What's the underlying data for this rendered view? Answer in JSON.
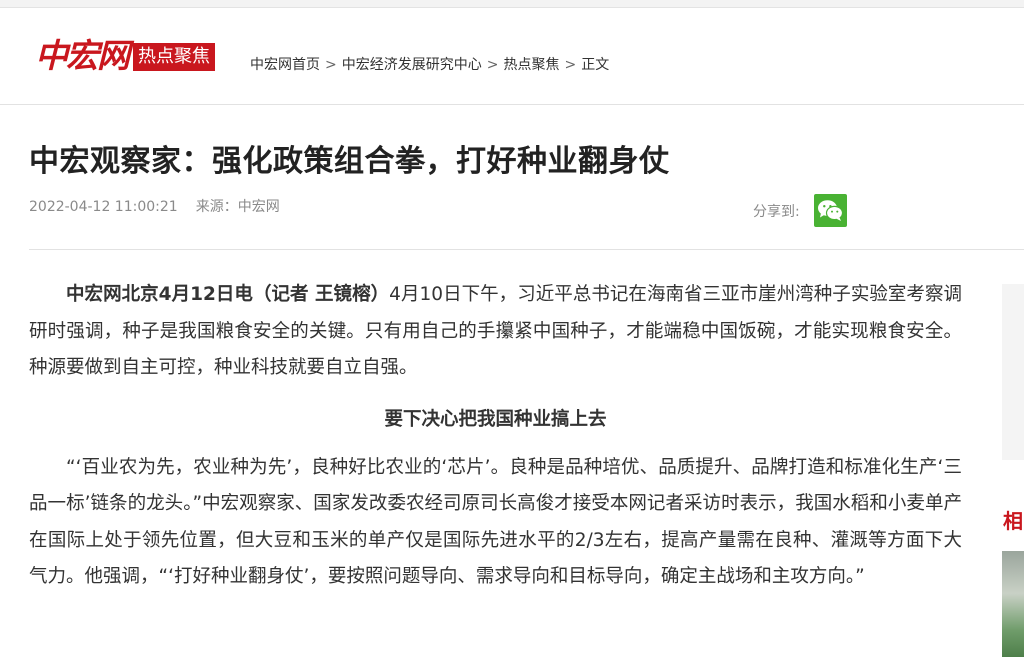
{
  "header": {
    "logo_text": "中宏网",
    "channel_tag": "热点聚焦",
    "breadcrumb": [
      "中宏网首页",
      "中宏经济发展研究中心",
      "热点聚焦",
      "正文"
    ],
    "breadcrumb_separator": ">"
  },
  "article": {
    "title": "中宏观察家：强化政策组合拳，打好种业翻身仗",
    "datetime": "2022-04-12 11:00:21",
    "source": "来源：中宏网",
    "share_label": "分享到:",
    "share_icon": "wechat-icon",
    "para1_lead": "中宏网北京4月12日电（记者 王镜榕）",
    "para1_body": "4月10日下午，习近平总书记在海南省三亚市崖州湾种子实验室考察调研时强调，种子是我国粮食安全的关键。只有用自己的手攥紧中国种子，才能端稳中国饭碗，才能实现粮食安全。种源要做到自主可控，种业科技就要自立自强。",
    "subheading": "要下决心把我国种业搞上去",
    "para2": "“‘百业农为先，农业种为先’，良种好比农业的‘芯片’。良种是品种培优、品质提升、品牌打造和标准化生产‘三品一标’链条的龙头。”中宏观察家、国家发改委农经司原司长高俊才接受本网记者采访时表示，我国水稻和小麦单产在国际上处于领先位置，但大豆和玉米的单产仅是国际先进水平的2/3左右，提高产量需在良种、灌溉等方面下大气力。他强调，“‘打好种业翻身仗’，要按照问题导向、需求导向和目标导向，确定主战场和主攻方向。”"
  },
  "sidebar": {
    "heading": "相"
  },
  "colors": {
    "brand_red": "#c9171e",
    "wechat_green": "#49b233",
    "meta_gray": "#8a8a8a"
  }
}
